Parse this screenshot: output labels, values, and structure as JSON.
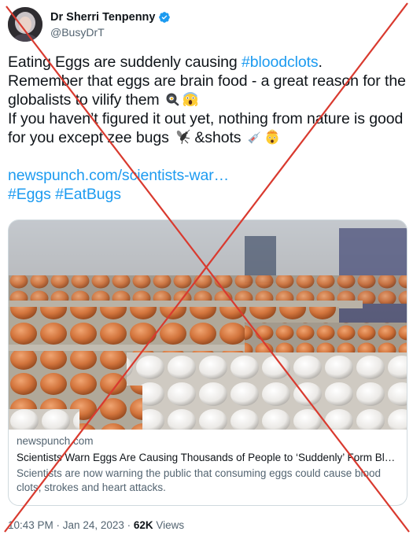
{
  "author": {
    "display_name": "Dr Sherri Tenpenny",
    "handle": "@BusyDrT",
    "verified": true,
    "verified_icon": "verified-badge-icon",
    "avatar_icon": "avatar-photo"
  },
  "tweet": {
    "line1_a": "Eating Eggs are suddenly causing ",
    "line1_hashtag": "#bloodclots",
    "line1_b": ".",
    "line2": "Remember that eggs are brain food - a great reason for the globalists to vilify them ",
    "line2_emojis": [
      "frying-pan-emoji",
      "screaming-face-emoji"
    ],
    "line3": "If you haven’t figured it out yet, nothing from nature is good for you except zee bugs ",
    "line3_bug_emoji": "mosquito-emoji",
    "line3_b": " &shots ",
    "line3_emojis": [
      "syringe-emoji",
      "exploding-head-emoji"
    ],
    "url_text": "newspunch.com/scientists-war…",
    "hashtags": [
      "#Eggs",
      "#EatBugs"
    ]
  },
  "card": {
    "image_description_icon": "eggs-in-trays-photo",
    "domain": "newspunch.com",
    "title": "Scientists Warn Eggs Are Causing Thousands of People to ‘Suddenly’ Form Bl…",
    "description": "Scientists are now warning the public that consuming eggs could cause blood clots, strokes and heart attacks."
  },
  "footer": {
    "time": "10:43 PM",
    "separator1": " · ",
    "date": "Jan 24, 2023",
    "separator2": " · ",
    "views_count": "62K",
    "views_label": " Views"
  },
  "overlay": {
    "icon": "red-x-overlay",
    "color": "#d93a2f"
  },
  "colors": {
    "link": "#1d9bf0",
    "text": "#0f1419",
    "secondary": "#536471",
    "border": "#cfd9de"
  }
}
